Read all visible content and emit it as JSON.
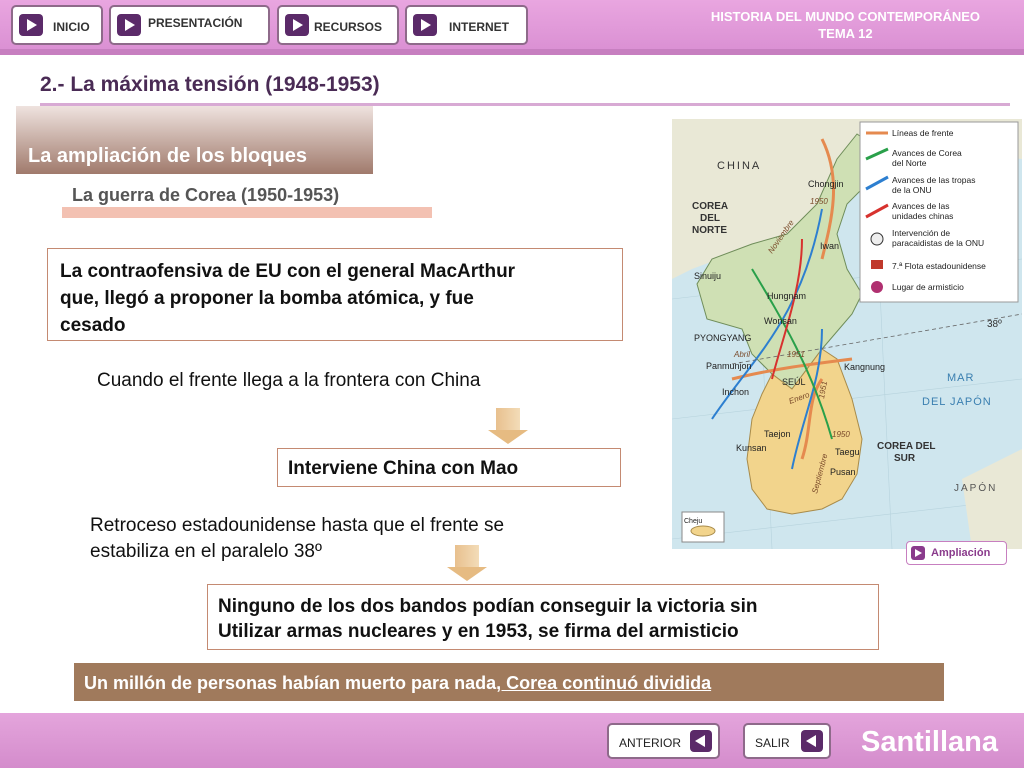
{
  "nav": {
    "inicio": "INICIO",
    "presentacion": "PRESENTACIÓN",
    "recursos": "RECURSOS",
    "internet": "INTERNET"
  },
  "header": {
    "line1": "HISTORIA DEL MUNDO CONTEMPORÁNEO",
    "line2": "TEMA 12"
  },
  "section_title": "2.- La máxima tensión (1948-1953)",
  "banner": "La ampliación de los bloques",
  "subtitle": "La guerra de Corea (1950-1953)",
  "box1": {
    "line1": "La contraofensiva de EU con el general MacArthur",
    "line2": "que,  llegó a proponer la bomba atómica, y fue",
    "line3": "cesado"
  },
  "text_frontera": "Cuando el frente llega a la frontera con China",
  "box2": "Interviene China con Mao",
  "text_retroceso": {
    "line1": "Retroceso estadounidense hasta que el frente se",
    "line2": "estabiliza en el paralelo 38º"
  },
  "box3": {
    "line1": "Ninguno de los dos bandos podían conseguir la victoria sin",
    "line2": "Utilizar armas nucleares y en 1953, se firma del armisticio"
  },
  "conclusion": {
    "part1": "Un millón de personas habían muerto para nada",
    "part2": ", Corea continuó dividida"
  },
  "map": {
    "china": "CHINA",
    "corea_norte_1": "COREA",
    "corea_norte_2": "DEL",
    "corea_norte_3": "NORTE",
    "corea_sur_1": "COREA DEL",
    "corea_sur_2": "SUR",
    "mar_1": "MAR",
    "mar_2": "DEL JAPÓN",
    "japon": "JAPÓN",
    "cities": [
      "Chongjin",
      "Iwan",
      "Sinuiju",
      "Hungnam",
      "PYONGYANG",
      "Wonsan",
      "Panmunjon",
      "SEÚL",
      "Kangnung",
      "Inchon",
      "Taejon",
      "Kunsan",
      "Taegu",
      "Pusan",
      "Cheju"
    ],
    "annotations": [
      "1950",
      "Noviembre",
      "Abril",
      "1951",
      "Enero",
      "1951",
      "1950",
      "Septiembre"
    ],
    "parallel": "38º",
    "legend": {
      "l1": "Líneas de frente",
      "l2a": "Avances de Corea",
      "l2b": "del Norte",
      "l3a": "Avances de las tropas",
      "l3b": "de la ONU",
      "l4a": "Avances de las",
      "l4b": "unidades chinas",
      "l5a": "Intervención de",
      "l5b": "paracaidistas de la ONU",
      "l6": "7.ª Flota estadounidense",
      "l7": "Lugar de armisticio"
    }
  },
  "ampliacion": "Ampliación",
  "footer": {
    "anterior": "ANTERIOR",
    "salir": "SALIR",
    "brand": "Santillana"
  },
  "colors": {
    "header_pink": "#d98ed2",
    "title_purple": "#4a2b55",
    "banner_brown": "#a07a6c",
    "bar_brown": "#a07a5c",
    "box_border": "#c48a72",
    "map_sea": "#cfe6ee",
    "map_land_north": "#cfe0b4",
    "map_land_south": "#f2d48c"
  }
}
